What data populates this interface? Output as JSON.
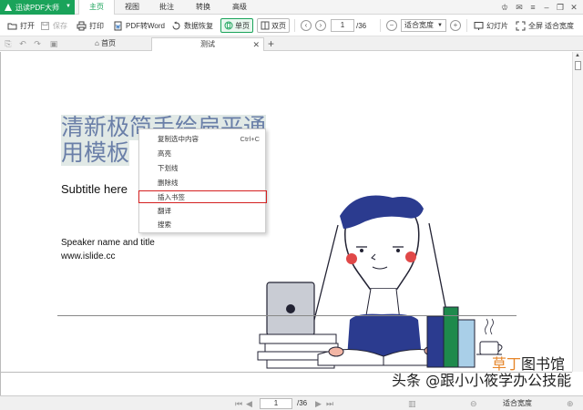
{
  "app": {
    "brand": "迅读PDF大师"
  },
  "menu": {
    "items": [
      "主页",
      "视图",
      "批注",
      "转换",
      "高级"
    ],
    "active": 0
  },
  "toolbar": {
    "open": "打开",
    "save": "保存",
    "print": "打印",
    "pdf2word": "PDF转Word",
    "recover": "数据恢复",
    "single": "单页",
    "double": "双页",
    "page": "1",
    "total": "/36",
    "zoom": "适合宽度",
    "slideshow": "幻灯片",
    "fullscreen": "全屏",
    "fitwidth": "适合宽度"
  },
  "tabs": {
    "home": "首页",
    "doc": "测试"
  },
  "document": {
    "title_line1": "清新极简手绘扁平通",
    "title_line2": "用模板",
    "subtitle": "Subtitle here",
    "speaker": "Speaker name and title",
    "site": "www.islide.cc"
  },
  "context_menu": {
    "items": [
      {
        "label": "复制选中内容",
        "shortcut": "Ctrl+C"
      },
      {
        "label": "高亮",
        "shortcut": ""
      },
      {
        "label": "下划线",
        "shortcut": ""
      },
      {
        "label": "删除线",
        "shortcut": ""
      },
      {
        "label": "插入书签",
        "shortcut": ""
      },
      {
        "label": "翻译",
        "shortcut": ""
      },
      {
        "label": "搜索",
        "shortcut": ""
      }
    ],
    "highlighted": 4
  },
  "status": {
    "page": "1",
    "total": "/36",
    "zoom": "适合宽度"
  },
  "watermark": {
    "text": "头条 @跟小小筱学办公技能",
    "site_a": "草丁",
    "site_b": "图书馆"
  },
  "colors": {
    "brand": "#1aa35a",
    "highlight_border": "#d42020",
    "title": "#6a7fa8"
  },
  "icons": [
    "app-logo-icon",
    "open-icon",
    "save-icon",
    "print-icon",
    "pdf2word-icon",
    "recover-icon",
    "single-page-icon",
    "double-page-icon",
    "prev-page-icon",
    "next-page-icon",
    "zoom-out-icon",
    "zoom-in-icon",
    "slideshow-icon",
    "fullscreen-icon"
  ]
}
